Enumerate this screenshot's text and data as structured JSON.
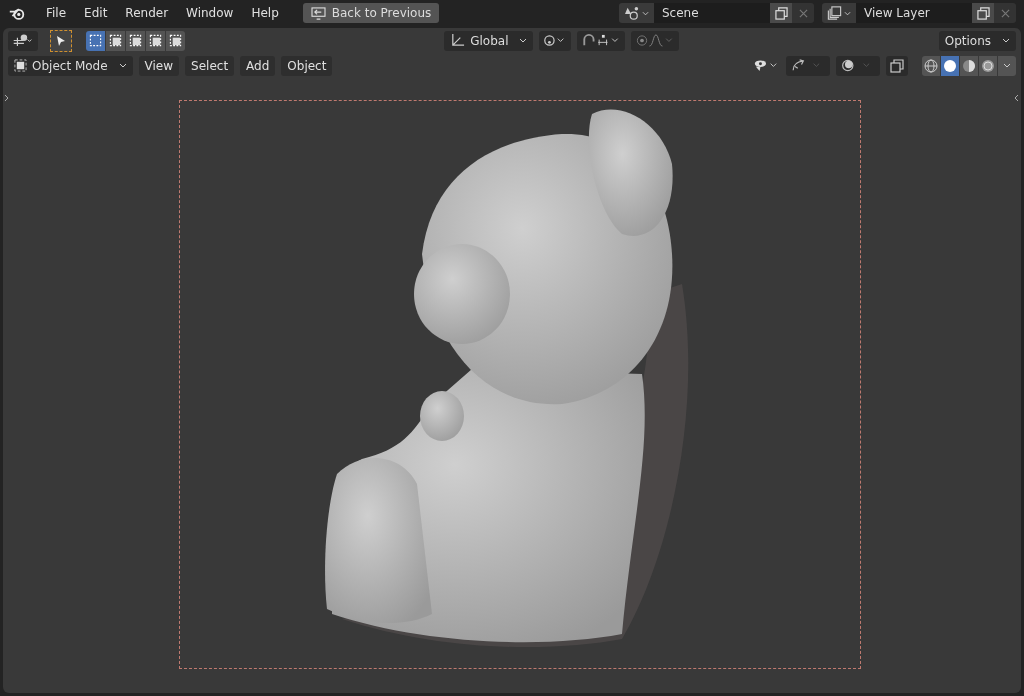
{
  "menu": [
    "File",
    "Edit",
    "Render",
    "Window",
    "Help"
  ],
  "back_button": "Back to Previous",
  "scene": {
    "value": "Scene"
  },
  "view_layer": {
    "value": "View Layer"
  },
  "toolbar": {
    "select_modes": [
      {
        "selected": true
      },
      {
        "selected": false
      },
      {
        "selected": false
      },
      {
        "selected": false
      },
      {
        "selected": false
      }
    ],
    "orientation": "Global",
    "options": "Options"
  },
  "header": {
    "mode": "Object Mode",
    "menus": [
      "View",
      "Select",
      "Add",
      "Object"
    ],
    "shading_modes": [
      {
        "selected": false
      },
      {
        "selected": true
      },
      {
        "selected": false
      },
      {
        "selected": false
      }
    ]
  }
}
